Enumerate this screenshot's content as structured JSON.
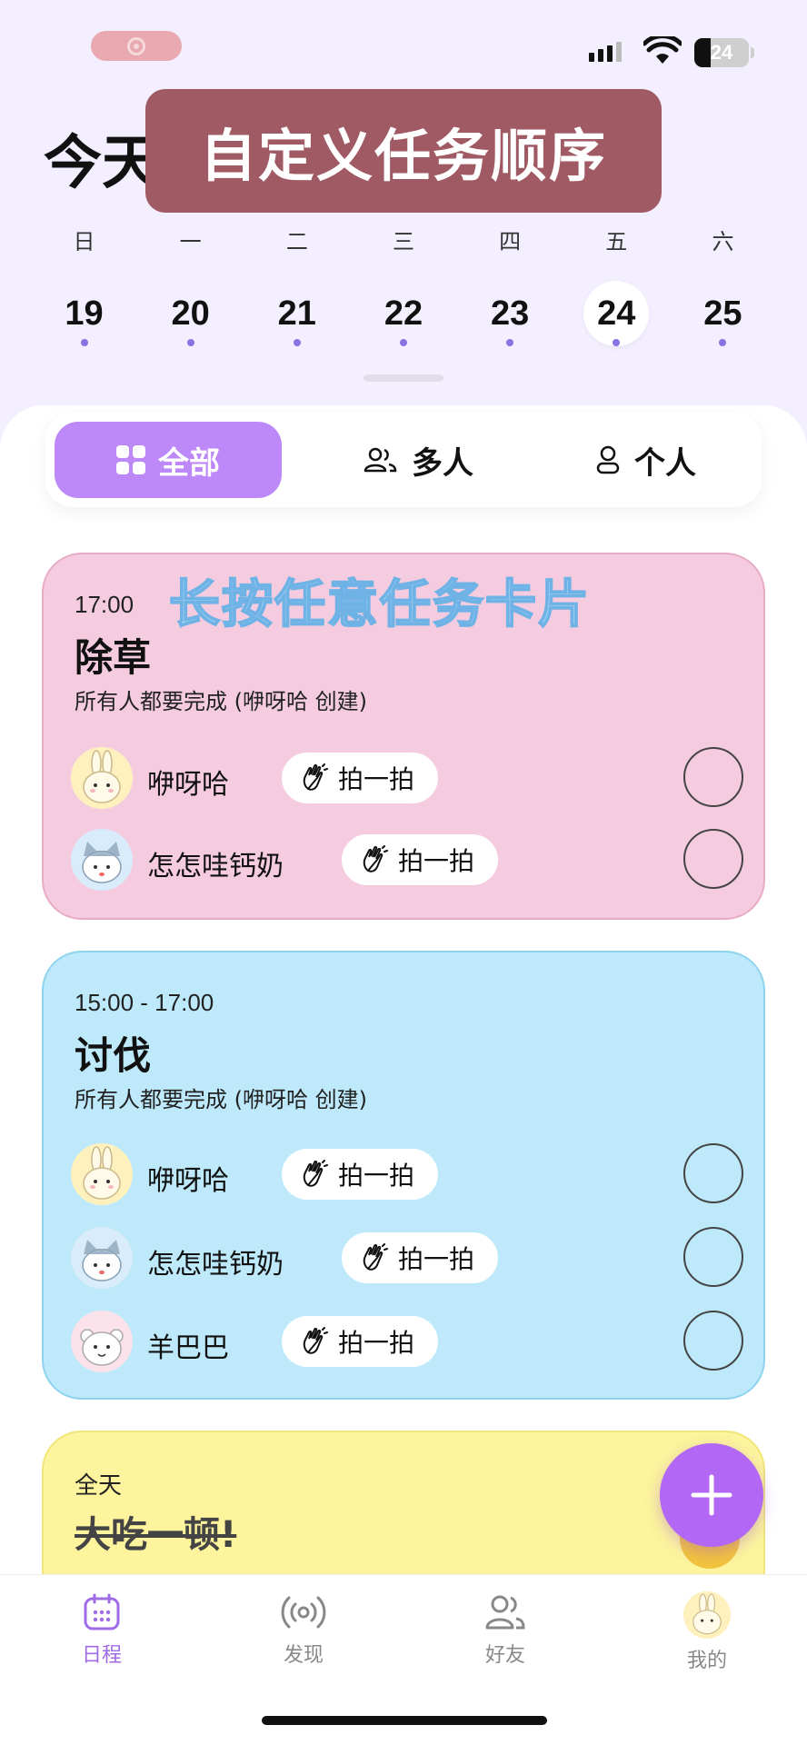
{
  "status_bar": {
    "battery": "24"
  },
  "header": {
    "title": "今天",
    "overlay_caption": "自定义任务顺序"
  },
  "week": {
    "weekdays": [
      "日",
      "一",
      "二",
      "三",
      "四",
      "五",
      "六"
    ],
    "dates": [
      "19",
      "20",
      "21",
      "22",
      "23",
      "24",
      "25"
    ],
    "selected_date": "24"
  },
  "filter": {
    "all": "全部",
    "multi": "多人",
    "personal": "个人",
    "active": "全部"
  },
  "hint_overlay": "长按任意任务卡片",
  "tasks": [
    {
      "time": "17:00",
      "title": "除草",
      "desc": "所有人都要完成 (咿呀哈 创建)",
      "members": [
        {
          "name": "咿呀哈",
          "action": "拍一拍"
        },
        {
          "name": "怎怎哇钙奶",
          "action": "拍一拍"
        }
      ]
    },
    {
      "time": "15:00 - 17:00",
      "title": "讨伐",
      "desc": "所有人都要完成 (咿呀哈 创建)",
      "members": [
        {
          "name": "咿呀哈",
          "action": "拍一拍"
        },
        {
          "name": "怎怎哇钙奶",
          "action": "拍一拍"
        },
        {
          "name": "羊巴巴",
          "action": "拍一拍"
        }
      ]
    },
    {
      "time": "全天",
      "title": "大吃一顿!",
      "completed": true
    }
  ],
  "tabbar": {
    "schedule": "日程",
    "discover": "发现",
    "friends": "好友",
    "mine": "我的"
  },
  "colors": {
    "accent": "#bd88f7",
    "fab": "#b267f5",
    "pink_card": "#f5ccdf",
    "blue_card": "#bde9fb",
    "yellow_card": "#fdf49d",
    "overlay": "#a05a63"
  }
}
